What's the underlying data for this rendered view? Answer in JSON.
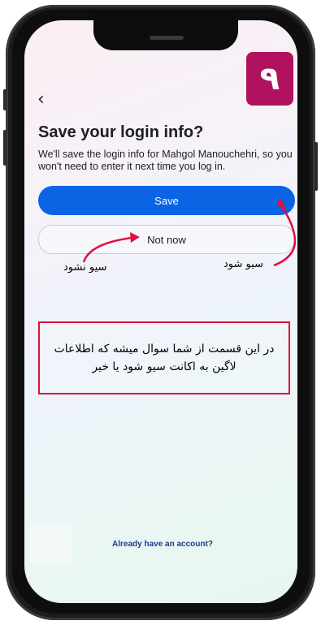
{
  "badge": {
    "digit": "۹",
    "color": "#b0125f"
  },
  "nav": {
    "back_icon": "‹"
  },
  "login": {
    "title": "Save your login info?",
    "description": "We'll save the login info for Mahgol Manouchehri, so you won't need to enter it next time you log in.",
    "save_label": "Save",
    "not_now_label": "Not now",
    "already_account": "Already have an account?"
  },
  "annotations": {
    "save_label_fa": "سیو شود",
    "not_save_label_fa": "سیو نشود",
    "callout_line1": "در این قسمت از شما سوال میشه که اطلاعات",
    "callout_line2": "لاگین به اکانت سیو شود یا خیر",
    "arrow_color": "#e0103b"
  },
  "colors": {
    "primary": "#0a64e4",
    "text": "#1c1e21"
  }
}
